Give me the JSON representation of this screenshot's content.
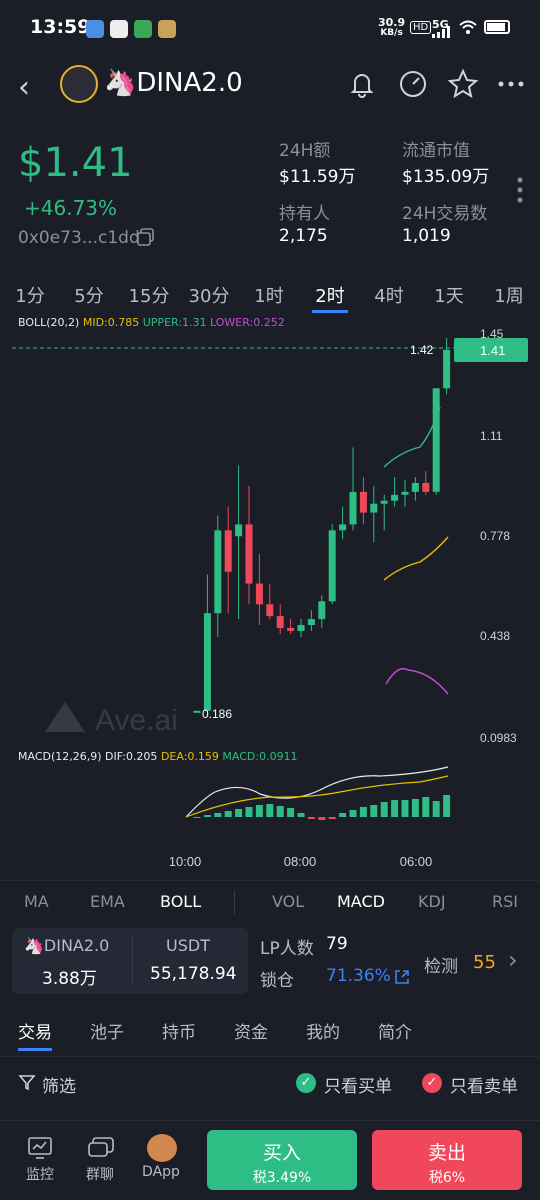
{
  "status_bar": {
    "time": "13:59",
    "net_speed": "30.9",
    "net_unit": "KB/s",
    "hd": "HD",
    "signal": "5G",
    "battery": ""
  },
  "header": {
    "token_name": "🦄DINA2.0"
  },
  "price_block": {
    "price": "$1.41",
    "change": "+46.73%",
    "address": "0x0e73...c1dd"
  },
  "stats": [
    {
      "label": "24H额",
      "value": "$11.59万"
    },
    {
      "label": "流通市值",
      "value": "$135.09万"
    },
    {
      "label": "持有人",
      "value": "2,175"
    },
    {
      "label": "24H交易数",
      "value": "1,019"
    }
  ],
  "intervals": [
    "1分",
    "5分",
    "15分",
    "30分",
    "1时",
    "2时",
    "4时",
    "1天",
    "1周"
  ],
  "active_interval": "2时",
  "boll_legend": {
    "name": "BOLL(20,2)",
    "mid": "MID:0.785",
    "upper": "UPPER:1.31",
    "lower": "LOWER:0.252"
  },
  "macd_legend": {
    "name": "MACD(12,26,9)",
    "dif": "DIF:0.205",
    "dea": "DEA:0.159",
    "macd": "MACD:0.0911"
  },
  "chart_data": {
    "type": "candlestick",
    "y_axis_ticks": [
      "1.45",
      "1.11",
      "0.778",
      "0.438",
      "0.0983"
    ],
    "x_axis_ticks": [
      "10:00",
      "08:00",
      "06:00"
    ],
    "current_price_label": "1.41",
    "last_price_marker": "1.42",
    "low_marker": "0.186",
    "candles": [
      {
        "o": 0.19,
        "h": 0.19,
        "l": 0.186,
        "c": 0.19
      },
      {
        "o": 0.19,
        "h": 0.65,
        "l": 0.186,
        "c": 0.52
      },
      {
        "o": 0.52,
        "h": 0.85,
        "l": 0.44,
        "c": 0.8
      },
      {
        "o": 0.8,
        "h": 0.88,
        "l": 0.52,
        "c": 0.66
      },
      {
        "o": 0.78,
        "h": 1.02,
        "l": 0.5,
        "c": 0.82
      },
      {
        "o": 0.82,
        "h": 0.95,
        "l": 0.55,
        "c": 0.62
      },
      {
        "o": 0.62,
        "h": 0.72,
        "l": 0.48,
        "c": 0.55
      },
      {
        "o": 0.55,
        "h": 0.62,
        "l": 0.5,
        "c": 0.51
      },
      {
        "o": 0.51,
        "h": 0.55,
        "l": 0.45,
        "c": 0.47
      },
      {
        "o": 0.47,
        "h": 0.5,
        "l": 0.45,
        "c": 0.46
      },
      {
        "o": 0.46,
        "h": 0.5,
        "l": 0.44,
        "c": 0.48
      },
      {
        "o": 0.48,
        "h": 0.53,
        "l": 0.46,
        "c": 0.5
      },
      {
        "o": 0.5,
        "h": 0.58,
        "l": 0.47,
        "c": 0.56
      },
      {
        "o": 0.56,
        "h": 0.82,
        "l": 0.55,
        "c": 0.8
      },
      {
        "o": 0.8,
        "h": 0.88,
        "l": 0.77,
        "c": 0.82
      },
      {
        "o": 0.82,
        "h": 1.08,
        "l": 0.8,
        "c": 0.93
      },
      {
        "o": 0.93,
        "h": 0.98,
        "l": 0.82,
        "c": 0.86
      },
      {
        "o": 0.86,
        "h": 0.95,
        "l": 0.76,
        "c": 0.89
      },
      {
        "o": 0.89,
        "h": 0.92,
        "l": 0.8,
        "c": 0.9
      },
      {
        "o": 0.9,
        "h": 0.98,
        "l": 0.88,
        "c": 0.92
      },
      {
        "o": 0.92,
        "h": 0.97,
        "l": 0.88,
        "c": 0.93
      },
      {
        "o": 0.93,
        "h": 0.98,
        "l": 0.9,
        "c": 0.96
      },
      {
        "o": 0.96,
        "h": 1.0,
        "l": 0.92,
        "c": 0.93
      },
      {
        "o": 0.93,
        "h": 1.22,
        "l": 0.92,
        "c": 1.28
      },
      {
        "o": 1.28,
        "h": 1.45,
        "l": 1.26,
        "c": 1.41
      }
    ]
  },
  "indicator_tabs": [
    "MA",
    "EMA",
    "BOLL",
    "VOL",
    "MACD",
    "KDJ",
    "RSI"
  ],
  "active_indicators": [
    "BOLL",
    "MACD"
  ],
  "pair": {
    "token": "🦄DINA2.0",
    "token_amount": "3.88万",
    "quote": "USDT",
    "quote_amount": "55,178.94"
  },
  "liquidity": {
    "lp_label": "LP人数",
    "lp_value": "79",
    "lock_label": "锁仓",
    "lock_value": "71.36%",
    "check_label": "检测",
    "check_value": "55"
  },
  "content_tabs": [
    "交易",
    "池子",
    "持币",
    "资金",
    "我的",
    "简介"
  ],
  "active_content_tab": "交易",
  "filter": {
    "label": "筛选",
    "buy_only": "只看买单",
    "sell_only": "只看卖单"
  },
  "bottom_nav": [
    {
      "label": "监控",
      "icon": "monitor-icon"
    },
    {
      "label": "群聊",
      "icon": "chat-icon"
    },
    {
      "label": "DApp",
      "icon": "pancake-icon"
    }
  ],
  "buy": {
    "label": "买入",
    "tax": "税3.49%"
  },
  "sell": {
    "label": "卖出",
    "tax": "税6%"
  },
  "colors": {
    "up": "#2ebd85",
    "down": "#f0475a",
    "accent": "#3b82f6",
    "bg": "#1b1e27"
  }
}
